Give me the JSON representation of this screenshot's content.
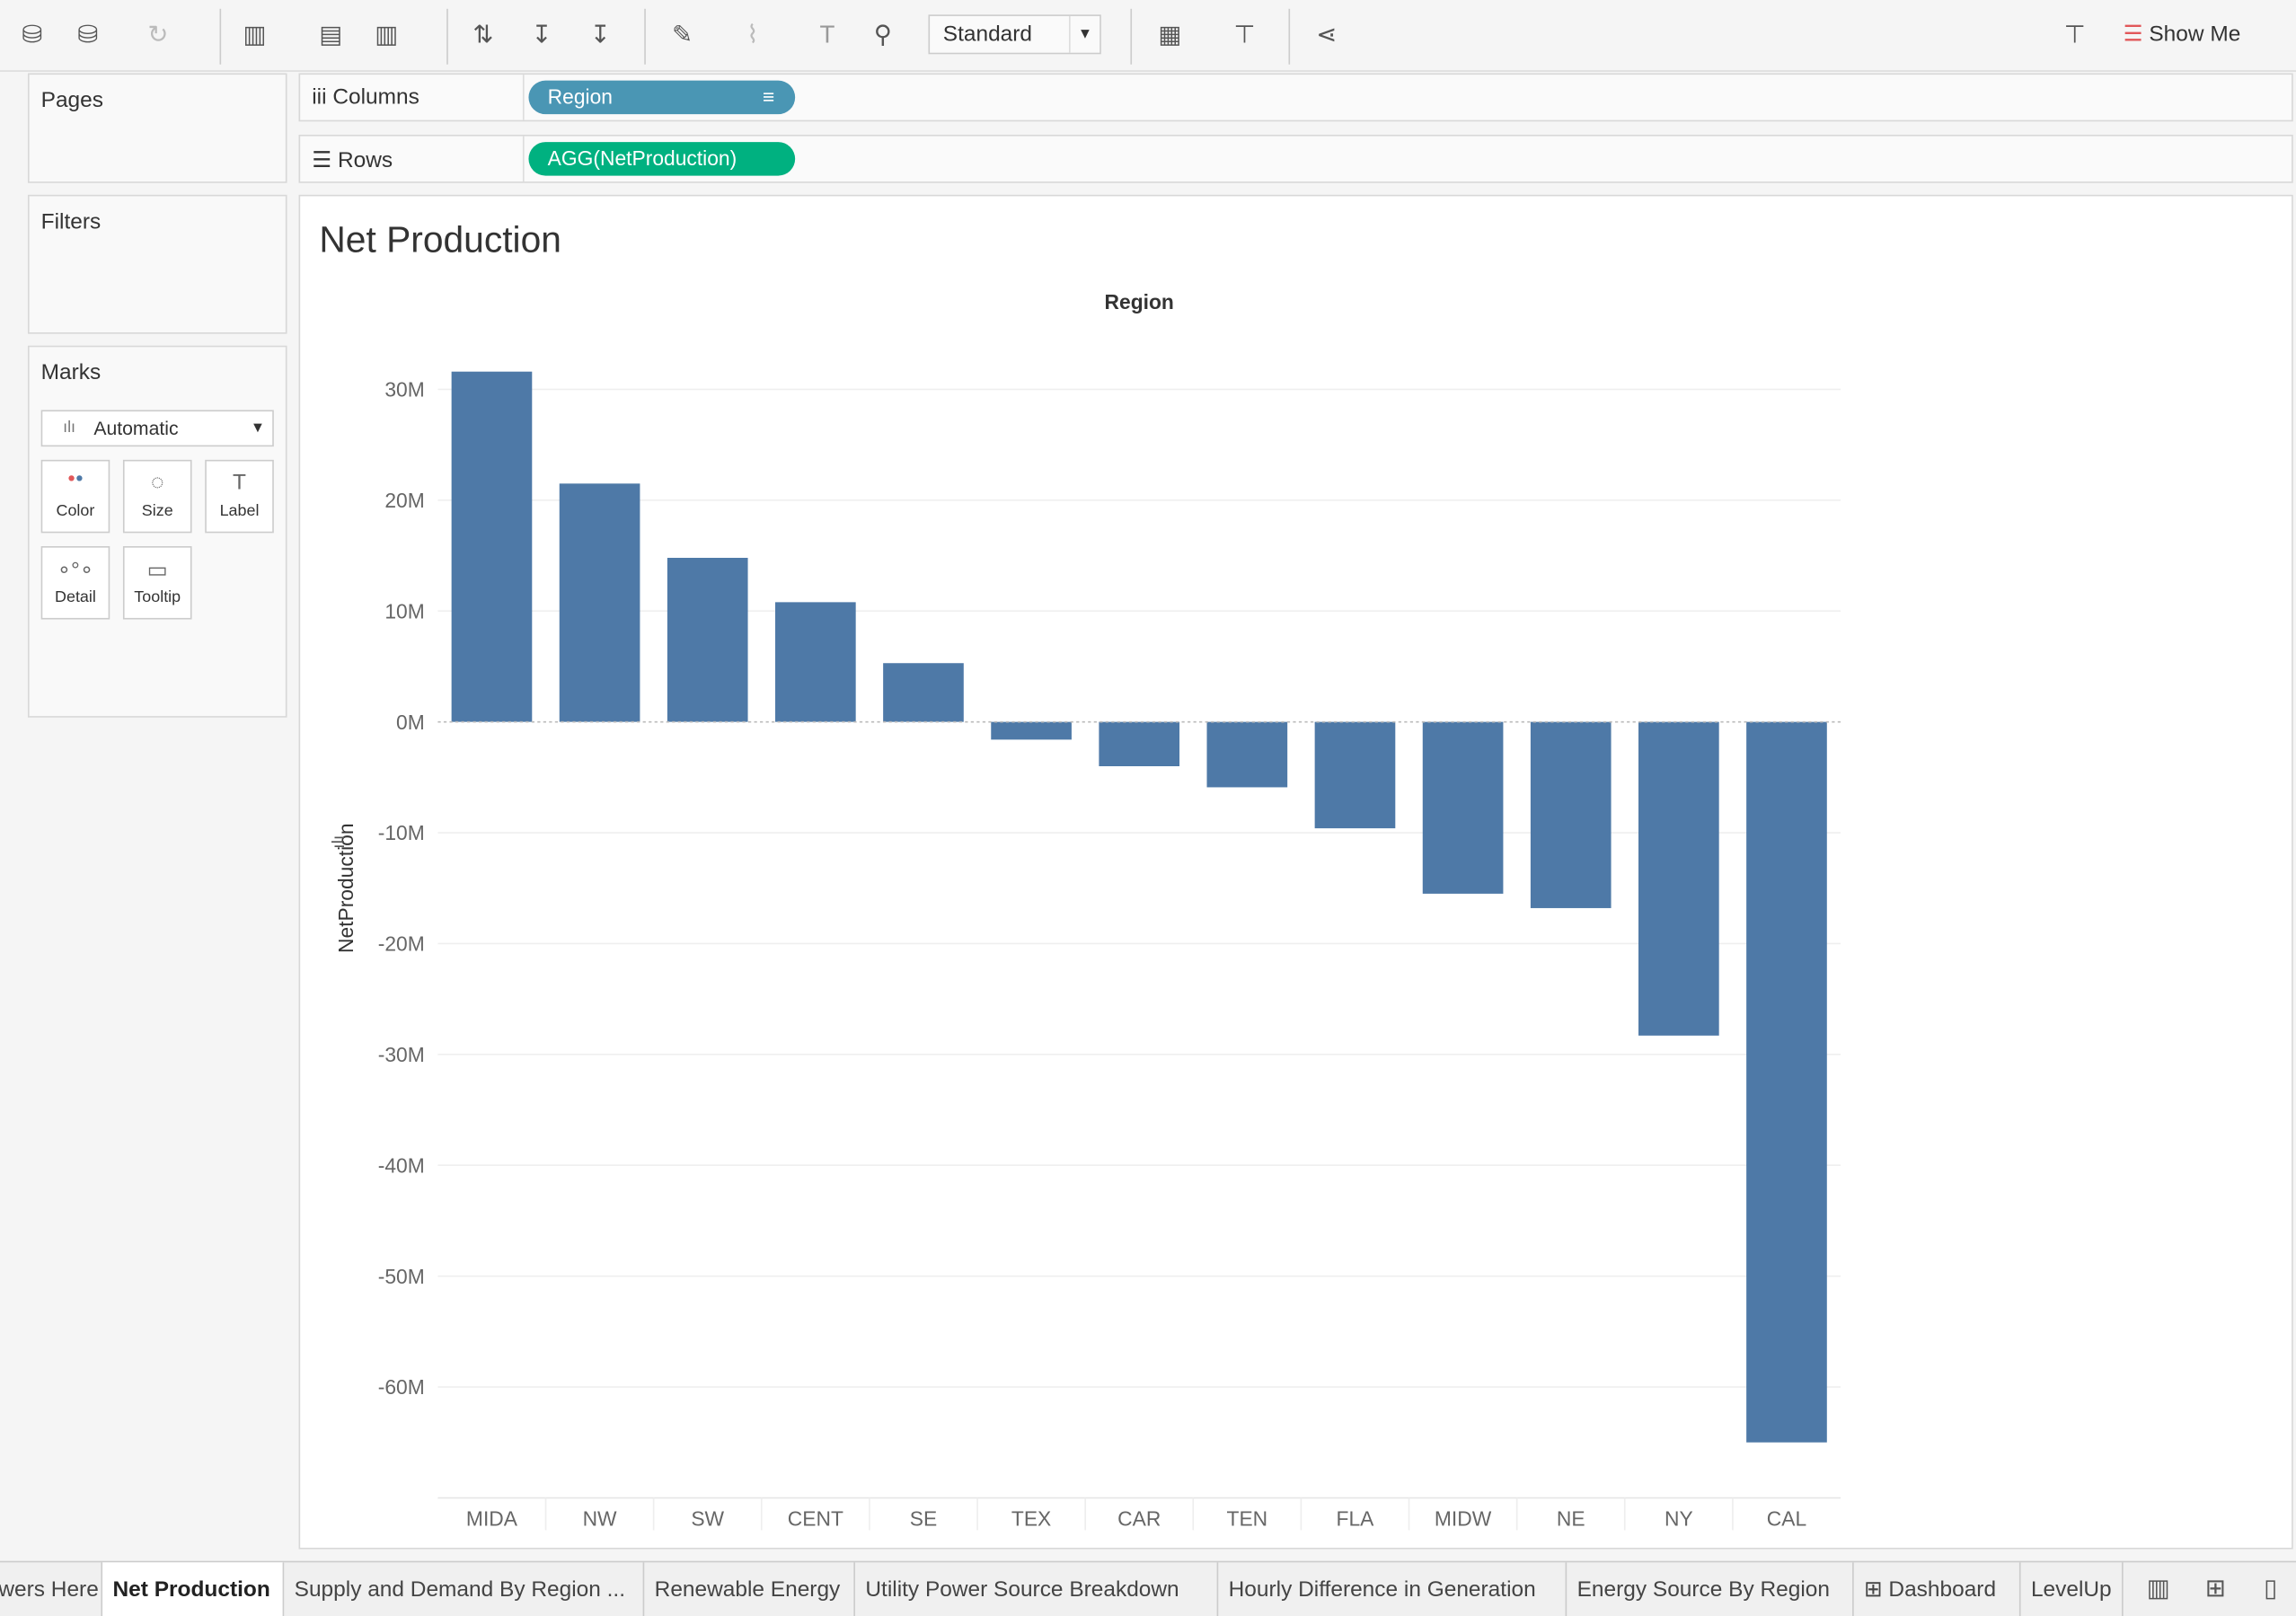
{
  "toolbar": {
    "mark_type_select": "Standard",
    "show_me": "Show Me"
  },
  "panels": {
    "pages": "Pages",
    "filters": "Filters",
    "marks": "Marks",
    "marks_type": "Automatic",
    "mark_buttons": [
      {
        "label": "Color",
        "icon": "color-icon"
      },
      {
        "label": "Size",
        "icon": "size-icon"
      },
      {
        "label": "Label",
        "icon": "label-icon"
      },
      {
        "label": "Detail",
        "icon": "detail-icon"
      },
      {
        "label": "Tooltip",
        "icon": "tooltip-icon"
      }
    ]
  },
  "shelves": {
    "columns_label": "Columns",
    "columns_pill": "Region",
    "rows_label": "Rows",
    "rows_pill": "AGG(NetProduction)",
    "columns_color": "#4a96b4",
    "rows_color": "#00b180"
  },
  "sheet_title": "Net Production",
  "tabs": [
    {
      "label": "wers Here"
    },
    {
      "label": "Net Production",
      "active": true
    },
    {
      "label": "Supply and Demand By Region ..."
    },
    {
      "label": "Renewable Energy"
    },
    {
      "label": "Utility Power Source Breakdown"
    },
    {
      "label": "Hourly Difference in Generation"
    },
    {
      "label": "Energy Source By Region"
    },
    {
      "label": "Dashboard"
    },
    {
      "label": "LevelUp"
    }
  ],
  "chart_data": {
    "type": "bar",
    "xlabel": "Region",
    "ylabel": "NetProduction",
    "categories": [
      "MIDA",
      "NW",
      "SW",
      "CENT",
      "SE",
      "TEX",
      "CAR",
      "TEN",
      "FLA",
      "MIDW",
      "NE",
      "NY",
      "CAL"
    ],
    "values": [
      31.6,
      21.5,
      14.8,
      10.8,
      5.3,
      -1.6,
      -4.0,
      -5.9,
      -9.6,
      -15.5,
      -16.8,
      -28.3,
      -65.0
    ],
    "value_unit": "M",
    "yticks": [
      "30M",
      "20M",
      "10M",
      "0M",
      "-10M",
      "-20M",
      "-30M",
      "-40M",
      "-50M",
      "-60M"
    ],
    "ytick_values": [
      30,
      20,
      10,
      0,
      -10,
      -20,
      -30,
      -40,
      -50,
      -60
    ],
    "ylim": [
      -70,
      35
    ],
    "bar_color": "#4e79a7",
    "grid": true
  }
}
